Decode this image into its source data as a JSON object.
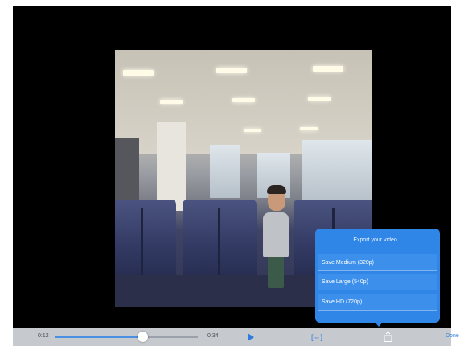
{
  "player": {
    "current_time": "0:12",
    "duration": "0:34",
    "progress": 0.61
  },
  "toolbar": {
    "done_label": "Done"
  },
  "export_menu": {
    "title": "Export your video...",
    "options": [
      {
        "label": "Save Medium (320p)"
      },
      {
        "label": "Save Large (540p)"
      },
      {
        "label": "Save HD (720p)"
      }
    ]
  },
  "colors": {
    "accent": "#2f7ce0",
    "popover": "#2f86e6",
    "toolbar": "#c6c9ce"
  },
  "icons": [
    "play-icon",
    "aspect-ratio-icon",
    "share-icon"
  ]
}
